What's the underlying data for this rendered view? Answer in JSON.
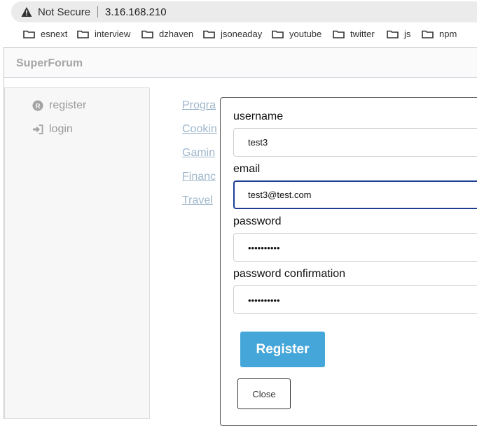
{
  "browser": {
    "security_label": "Not Secure",
    "url": "3.16.168.210",
    "bookmarks": [
      {
        "label": "esnext"
      },
      {
        "label": "interview"
      },
      {
        "label": "dzhaven"
      },
      {
        "label": "jsoneaday"
      },
      {
        "label": "youtube"
      },
      {
        "label": "twitter"
      },
      {
        "label": "js"
      },
      {
        "label": "npm"
      }
    ]
  },
  "app": {
    "brand": "SuperForum"
  },
  "sidebar": {
    "items": [
      {
        "label": "register",
        "icon": "registered-icon"
      },
      {
        "label": "login",
        "icon": "sign-in-icon"
      }
    ]
  },
  "categories": [
    "Progra",
    "Cookin",
    "Gamin",
    "Financ",
    "Travel"
  ],
  "modal": {
    "fields": {
      "username": {
        "label": "username",
        "value": "test3"
      },
      "email": {
        "label": "email",
        "value": "test3@test.com"
      },
      "password": {
        "label": "password",
        "value": "••••••••••"
      },
      "password_confirmation": {
        "label": "password confirmation",
        "value": "••••••••••"
      }
    },
    "register_label": "Register",
    "close_label": "Close"
  },
  "colors": {
    "accent": "#45a6d9",
    "focus_border": "#1c3f94",
    "link": "#9fb6cb"
  }
}
